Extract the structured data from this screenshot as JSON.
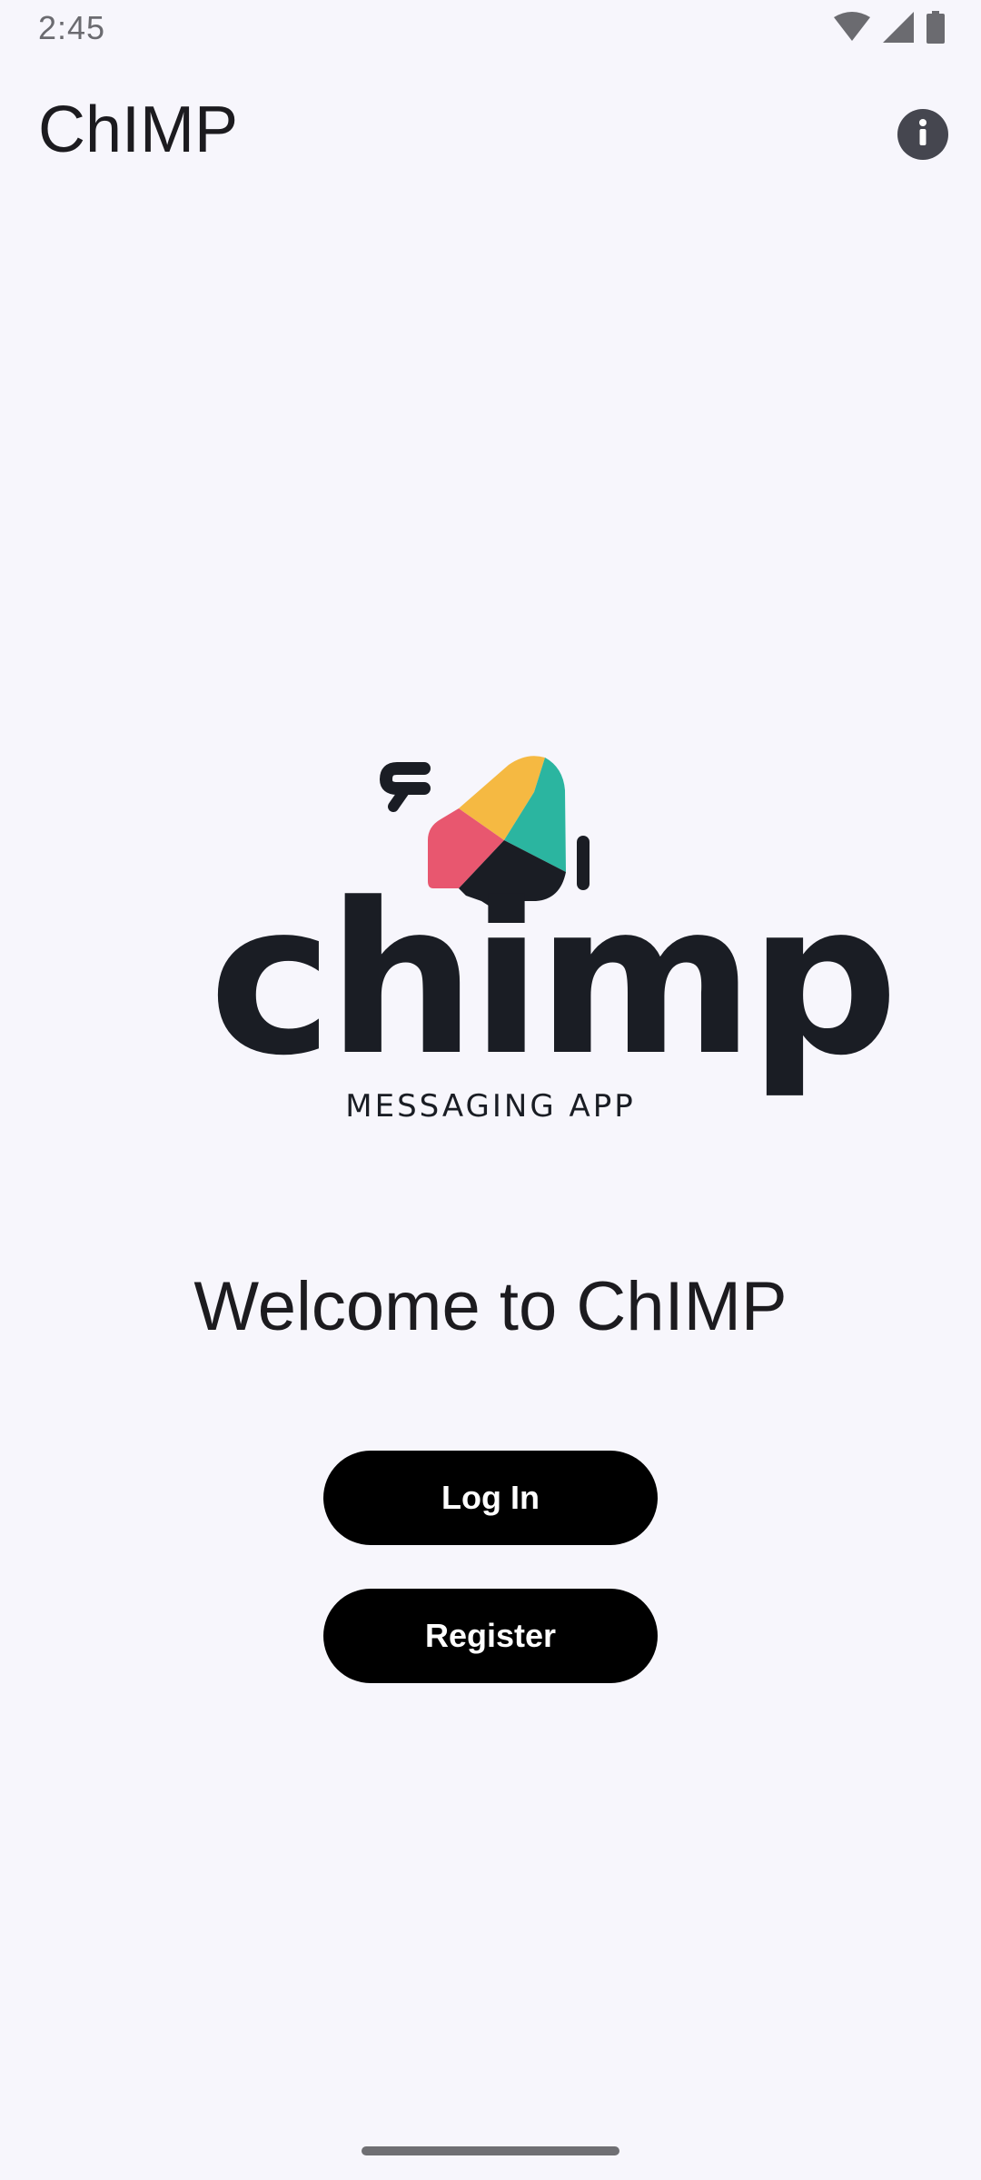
{
  "status_bar": {
    "time": "2:45",
    "icons": [
      "wifi-icon",
      "cell-signal-icon",
      "battery-icon"
    ]
  },
  "app_bar": {
    "title": "ChIMP",
    "action_icon": "info-icon"
  },
  "logo": {
    "wordmark": "chimp",
    "tagline": "MESSAGING APP",
    "colors": {
      "yellow": "#f5b942",
      "teal": "#2bb5a0",
      "pink": "#e8576f",
      "dark": "#1a1d24"
    }
  },
  "welcome": {
    "title": "Welcome to ChIMP"
  },
  "actions": {
    "login_label": "Log In",
    "register_label": "Register"
  },
  "theme": {
    "background": "#f7f6fc",
    "button_bg": "#000000",
    "button_text": "#ffffff"
  }
}
